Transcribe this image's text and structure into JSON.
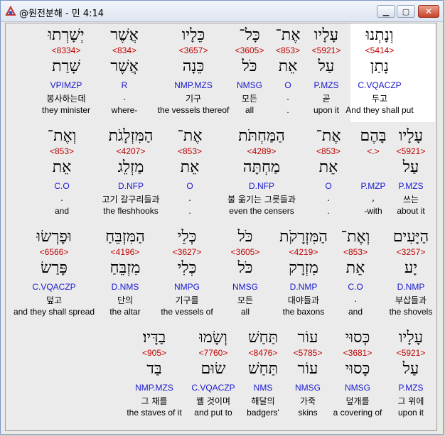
{
  "window": {
    "title": "@원전분해 - 민 4:14"
  },
  "rows": [
    [
      {
        "heb": "וְנָתְנוּ",
        "num": "<5414>",
        "root": "נָתַן",
        "morph": "C.VQACZP",
        "kor": "두고",
        "eng": "And they shall put"
      },
      {
        "heb": "עָלָיו",
        "num": "<5921>",
        "root": "עַל",
        "morph": "P.MZS",
        "kor": "곧",
        "eng": "upon it"
      },
      {
        "heb": "אֶת־",
        "num": "<853>",
        "root": "אֵת",
        "morph": "O",
        "kor": ".",
        "eng": "."
      },
      {
        "heb": "כָּל־",
        "num": "<3605>",
        "root": "כֹּל",
        "morph": "NMSG",
        "kor": "모든",
        "eng": "all"
      },
      {
        "heb": "כֵּלָיו",
        "num": "<3657>",
        "root": "כֵּנָה",
        "morph": "NMP.MZS",
        "kor": "기구",
        "eng": "the vessels thereof"
      },
      {
        "heb": "אֲשֶׁר",
        "num": "<834>",
        "root": "אֲשֶׁר",
        "morph": "R",
        "kor": ".",
        "eng": "where-"
      },
      {
        "heb": "יְשָׁרְתוּ",
        "num": "<8334>",
        "root": "שָׁרַת",
        "morph": "VPIMZP",
        "kor": "봉사하는데",
        "eng": "they minister"
      }
    ],
    [
      {
        "heb": "עָלָיו",
        "num": "<5921>",
        "root": "עַל",
        "morph": "P.MZS",
        "kor": "쓰는",
        "eng": "about it"
      },
      {
        "heb": "בָּהֶם",
        "num": "<.>",
        "root": "",
        "morph": "P.MZP",
        "kor": ",",
        "eng": "-with"
      },
      {
        "heb": "אֶת־",
        "num": "<853>",
        "root": "אֵת",
        "morph": "O",
        "kor": ".",
        "eng": "."
      },
      {
        "heb": "הַמַּחְתֹּת",
        "num": "<4289>",
        "root": "מַחְתָּה",
        "morph": "D.NFP",
        "kor": "불 옮기는 그릇들과",
        "eng": "even the censers"
      },
      {
        "heb": "אֶת־",
        "num": "<853>",
        "root": "אֵת",
        "morph": "O",
        "kor": ".",
        "eng": "."
      },
      {
        "heb": "הַמִּזְלָגֹת",
        "num": "<4207>",
        "root": "מַזְלֵג",
        "morph": "D.NFP",
        "kor": "고기 갈구리들과",
        "eng": "the fleshhooks"
      },
      {
        "heb": "וְאֶת־",
        "num": "<853>",
        "root": "אֵת",
        "morph": "C.O",
        "kor": ".",
        "eng": "and"
      }
    ],
    [
      {
        "heb": "הַיָּעִים",
        "num": "<3257>",
        "root": "יָע",
        "morph": "D.NMP",
        "kor": "부삽들과",
        "eng": "the shovels"
      },
      {
        "heb": "וְאֶת־",
        "num": "<853>",
        "root": "אֵת",
        "morph": "C.O",
        "kor": ".",
        "eng": "and"
      },
      {
        "heb": "הַמִּזְרָקֹת",
        "num": "<4219>",
        "root": "מִזְרָק",
        "morph": "D.NMP",
        "kor": "대야들과",
        "eng": "the baxons"
      },
      {
        "heb": "כֹּל",
        "num": "<3605>",
        "root": "כֹּל",
        "morph": "NMSG",
        "kor": "모든",
        "eng": "all"
      },
      {
        "heb": "כְּלֵי",
        "num": "<3627>",
        "root": "כְּלִי",
        "morph": "NMPG",
        "kor": "기구를",
        "eng": "the vessels of"
      },
      {
        "heb": "הַמִּזְבֵּחַ",
        "num": "<4196>",
        "root": "מִזְבֵּחַ",
        "morph": "D.NMS",
        "kor": "단의",
        "eng": "the altar"
      },
      {
        "heb": "וּפָרְשׂוּ",
        "num": "<6566>",
        "root": "פָּרַשׂ",
        "morph": "C.VQACZP",
        "kor": "덮고",
        "eng": "and they shall spread"
      }
    ],
    [
      {
        "heb": "עָלָיו",
        "num": "<5921>",
        "root": "עַל",
        "morph": "P.MZS",
        "kor": "그 위에",
        "eng": "upon it"
      },
      {
        "heb": "כְּסוּי",
        "num": "<3681>",
        "root": "כָּסוּי",
        "morph": "NMSG",
        "kor": "덮개를",
        "eng": "a covering of"
      },
      {
        "heb": "עוֹר",
        "num": "<5785>",
        "root": "עוֹר",
        "morph": "NMSG",
        "kor": "가죽",
        "eng": "skins"
      },
      {
        "heb": "תַּחַשׁ",
        "num": "<8476>",
        "root": "תַּחַשׁ",
        "morph": "NMS",
        "kor": "해달의",
        "eng": "badgers'"
      },
      {
        "heb": "וְשָׂמוּ",
        "num": "<7760>",
        "root": "שׂוּם",
        "morph": "C.VQACZP",
        "kor": "꿸 것이며",
        "eng": "and put to"
      },
      {
        "heb": "בַדָּיו׃",
        "num": "<905>",
        "root": "בַּד",
        "morph": "NMP.MZS",
        "kor": "그 채를",
        "eng": "the staves of it"
      }
    ]
  ]
}
